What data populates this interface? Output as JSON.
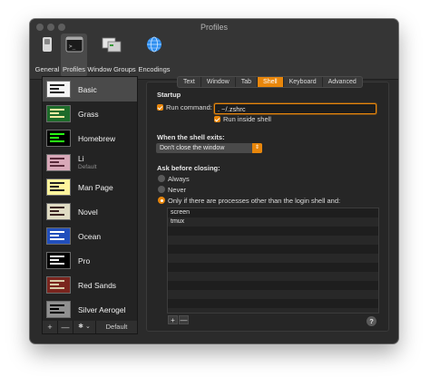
{
  "window": {
    "title": "Profiles"
  },
  "toolbar": {
    "items": [
      {
        "label": "General",
        "icon": "switch-icon"
      },
      {
        "label": "Profiles",
        "icon": "terminal-icon",
        "selected": true
      },
      {
        "label": "Window Groups",
        "icon": "window-groups-icon"
      },
      {
        "label": "Encodings",
        "icon": "globe-icon"
      }
    ]
  },
  "sidebar": {
    "profiles": [
      {
        "name": "Basic",
        "selected": true,
        "bg": "#f3f3f3",
        "fg": "#222222"
      },
      {
        "name": "Grass",
        "bg": "#1d6b2a",
        "fg": "#f5e9a0"
      },
      {
        "name": "Homebrew",
        "bg": "#000000",
        "fg": "#28fe14"
      },
      {
        "name": "Li",
        "sub": "Default",
        "bg": "#d8a8b8",
        "fg": "#5a2a3a"
      },
      {
        "name": "Man Page",
        "bg": "#fef49c",
        "fg": "#222222"
      },
      {
        "name": "Novel",
        "bg": "#dfdbc3",
        "fg": "#3b2322"
      },
      {
        "name": "Ocean",
        "bg": "#224fbc",
        "fg": "#ffffff"
      },
      {
        "name": "Pro",
        "bg": "#000000",
        "fg": "#f2f2f2"
      },
      {
        "name": "Red Sands",
        "bg": "#7a251e",
        "fg": "#d7c9a7"
      },
      {
        "name": "Silver Aerogel",
        "bg": "#909090",
        "fg": "#000000"
      }
    ],
    "footer": {
      "add": "+",
      "remove": "—",
      "gear": "✱ ⌄",
      "default_label": "Default"
    }
  },
  "tabs": [
    {
      "label": "Text"
    },
    {
      "label": "Window"
    },
    {
      "label": "Tab"
    },
    {
      "label": "Shell",
      "selected": true
    },
    {
      "label": "Keyboard"
    },
    {
      "label": "Advanced"
    }
  ],
  "shell": {
    "startup_heading": "Startup",
    "run_command_label": "Run command:",
    "run_command_checked": true,
    "run_command_value": ". ~/.zshrc",
    "run_inside_shell_label": "Run inside shell",
    "run_inside_shell_checked": true,
    "exit_heading": "When the shell exits:",
    "exit_action": "Don't close the window",
    "ask_heading": "Ask before closing:",
    "ask_options": [
      {
        "label": "Always",
        "selected": false
      },
      {
        "label": "Never",
        "selected": false
      },
      {
        "label": "Only if there are processes other than the login shell and:",
        "selected": true
      }
    ],
    "processes": [
      "screen",
      "tmux"
    ],
    "list_add": "+",
    "list_remove": "—",
    "help": "?"
  },
  "colors": {
    "accent": "#e8860b",
    "window_bg": "#2b2b2b",
    "titlebar_bg": "#353535"
  }
}
